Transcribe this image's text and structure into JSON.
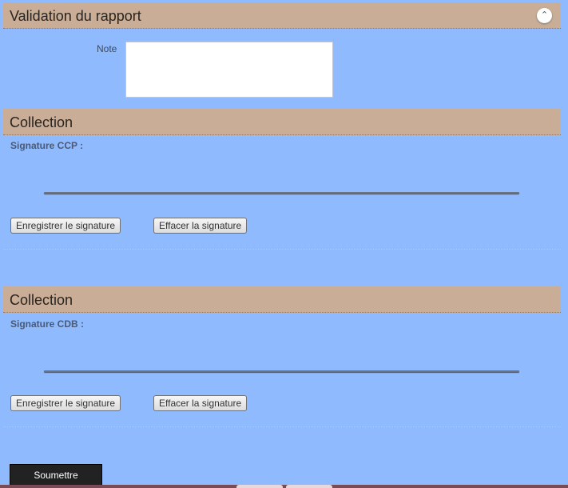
{
  "validation": {
    "title": "Validation du rapport",
    "note_label": "Note",
    "note_value": "",
    "collapse_icon": "chevron-up-icon"
  },
  "collections": [
    {
      "title": "Collection",
      "signature_label": "Signature CCP :",
      "save_label": "Enregistrer le signature",
      "clear_label": "Effacer la signature"
    },
    {
      "title": "Collection",
      "signature_label": "Signature CDB :",
      "save_label": "Enregistrer le signature",
      "clear_label": "Effacer la signature"
    }
  ],
  "submit_label": "Soumettre",
  "colors": {
    "background": "#8fbafd",
    "header": "#c9ad96",
    "submit": "#222222"
  }
}
